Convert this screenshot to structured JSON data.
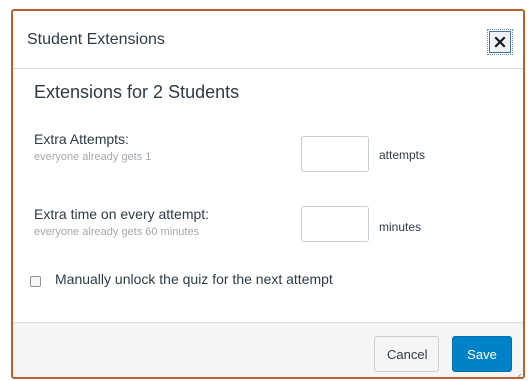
{
  "dialog": {
    "title": "Student Extensions",
    "heading": "Extensions for 2 Students",
    "extra_attempts": {
      "label": "Extra Attempts:",
      "hint": "everyone already gets 1",
      "value": "",
      "unit": "attempts"
    },
    "extra_time": {
      "label": "Extra time on every attempt:",
      "hint": "everyone already gets 60 minutes",
      "value": "",
      "unit": "minutes"
    },
    "unlock": {
      "label": "Manually unlock the quiz for the next attempt",
      "checked": false
    },
    "buttons": {
      "cancel": "Cancel",
      "save": "Save"
    }
  },
  "icons": {
    "close": "close-icon",
    "resize": "resize-grip-icon"
  },
  "colors": {
    "dialog_border": "#b5622e",
    "primary": "#0081c8",
    "text": "#2d3b45",
    "hint": "#a3a9ae",
    "footer_bg": "#f5f5f5"
  }
}
